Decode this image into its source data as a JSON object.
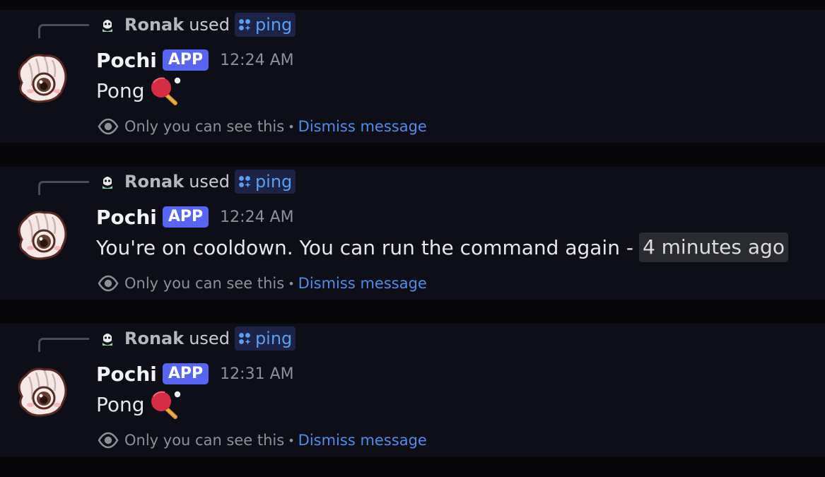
{
  "colors": {
    "background": "#070709",
    "message_background": "#0d0e17",
    "accent_link": "#4e8ce8",
    "app_badge": "#5865f2",
    "command_pill": "#1c2347"
  },
  "messages": [
    {
      "command": {
        "user": "Ronak",
        "used_text": "used",
        "name": "ping",
        "icon": "slash-command-icon"
      },
      "author": "Pochi",
      "badge": "APP",
      "timestamp": "12:24 AM",
      "text": "Pong",
      "emoji": "ping-pong-paddle-icon",
      "ephemeral": {
        "notice": "Only you can see this",
        "separator": "•",
        "dismiss": "Dismiss message"
      }
    },
    {
      "command": {
        "user": "Ronak",
        "used_text": "used",
        "name": "ping",
        "icon": "slash-command-icon"
      },
      "author": "Pochi",
      "badge": "APP",
      "timestamp": "12:24 AM",
      "text": "You're on cooldown. You can run the command again -",
      "relative_time": "4 minutes ago",
      "ephemeral": {
        "notice": "Only you can see this",
        "separator": "•",
        "dismiss": "Dismiss message"
      }
    },
    {
      "command": {
        "user": "Ronak",
        "used_text": "used",
        "name": "ping",
        "icon": "slash-command-icon"
      },
      "author": "Pochi",
      "badge": "APP",
      "timestamp": "12:31 AM",
      "text": "Pong",
      "emoji": "ping-pong-paddle-icon",
      "ephemeral": {
        "notice": "Only you can see this",
        "separator": "•",
        "dismiss": "Dismiss message"
      }
    }
  ]
}
